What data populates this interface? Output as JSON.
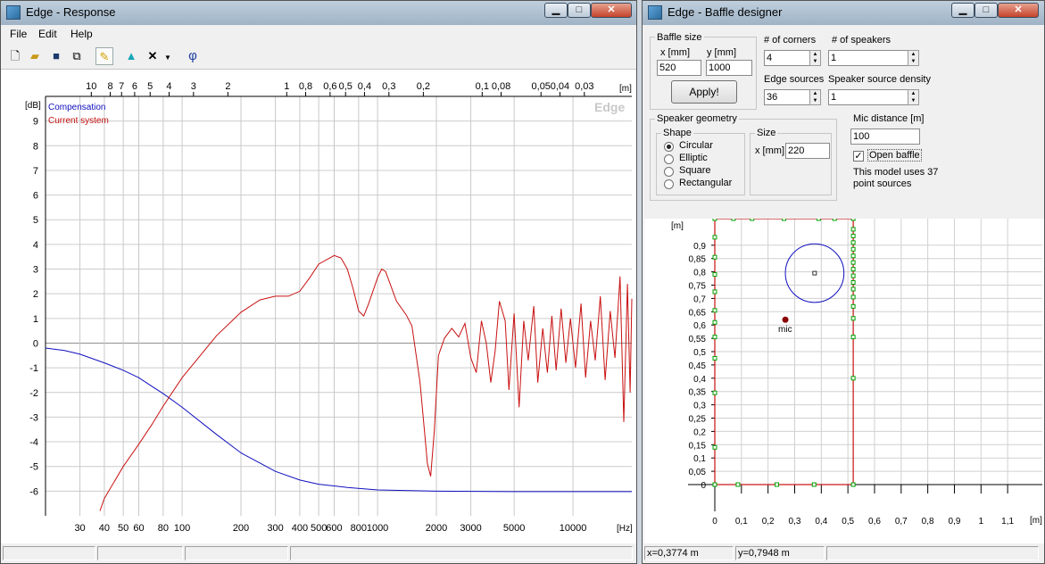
{
  "response_window": {
    "title": "Edge - Response",
    "menu": [
      "File",
      "Edit",
      "Help"
    ],
    "toolbar": {
      "phase_label": "φ"
    },
    "watermark": "Edge",
    "legend": [
      "Compensation",
      "Current system"
    ]
  },
  "designer_window": {
    "title": "Edge - Baffle designer",
    "baffle_size": {
      "group_label": "Baffle size",
      "x_label": "x [mm]",
      "x_value": "520",
      "y_label": "y [mm]",
      "y_value": "1000",
      "apply_label": "Apply!"
    },
    "corners": {
      "label": "# of corners",
      "value": "4"
    },
    "speakers": {
      "label": "# of speakers",
      "value": "1"
    },
    "edge_sources": {
      "label": "Edge sources",
      "value": "36"
    },
    "speaker_density": {
      "label": "Speaker source density",
      "value": "1"
    },
    "speaker_geometry": {
      "group_label": "Speaker geometry",
      "shape_label": "Shape",
      "shapes": [
        "Circular",
        "Elliptic",
        "Square",
        "Rectangular"
      ],
      "selected": "Circular",
      "size_label": "Size",
      "size_unit": "x [mm]",
      "size_value": "220"
    },
    "mic_distance": {
      "label": "Mic distance [m]",
      "value": "100"
    },
    "open_baffle": {
      "label": "Open baffle",
      "checked": true
    },
    "model_note": "This model uses 37 point sources",
    "status": {
      "x": "x=0,3774 m",
      "y": "y=0,7948 m"
    }
  },
  "chart_data": [
    {
      "type": "line",
      "title": "",
      "xlabel": "[Hz]",
      "ylabel": "[dB]",
      "xscale": "log",
      "xlim": [
        20,
        20000
      ],
      "ylim": [
        -7,
        10
      ],
      "x_ticks": [
        "30",
        "40",
        "50",
        "60",
        "80",
        "100",
        "200",
        "300",
        "400",
        "500",
        "600",
        "800",
        "1000",
        "2000",
        "3000",
        "5000",
        "10000"
      ],
      "y_ticks": [
        "9",
        "8",
        "7",
        "6",
        "5",
        "4",
        "3",
        "2",
        "1",
        "0",
        "-1",
        "-2",
        "-3",
        "-4",
        "-5",
        "-6"
      ],
      "top_axis_label": "[m]",
      "top_ticks": [
        "10",
        "8",
        "7",
        "6",
        "5",
        "4",
        "3",
        "2",
        "1",
        "0,8",
        "0,6",
        "0,5",
        "0,4",
        "0,3",
        "0,2",
        "0,1",
        "0,08",
        "0,05",
        "0,04",
        "0,03"
      ],
      "grid": true,
      "legend_position": "top-left",
      "series": [
        {
          "name": "Compensation",
          "color": "#1010c0",
          "points": [
            [
              20,
              -0.2
            ],
            [
              25,
              -0.3
            ],
            [
              30,
              -0.45
            ],
            [
              40,
              -0.8
            ],
            [
              50,
              -1.1
            ],
            [
              60,
              -1.4
            ],
            [
              70,
              -1.75
            ],
            [
              80,
              -2.05
            ],
            [
              100,
              -2.6
            ],
            [
              150,
              -3.7
            ],
            [
              200,
              -4.45
            ],
            [
              300,
              -5.2
            ],
            [
              400,
              -5.55
            ],
            [
              500,
              -5.72
            ],
            [
              700,
              -5.85
            ],
            [
              1000,
              -5.95
            ],
            [
              2000,
              -6.0
            ],
            [
              5000,
              -6.02
            ],
            [
              20000,
              -6.02
            ]
          ]
        },
        {
          "name": "Current system",
          "color": "#c81010",
          "points": [
            [
              38,
              -6.8
            ],
            [
              40,
              -6.3
            ],
            [
              50,
              -5.0
            ],
            [
              60,
              -4.1
            ],
            [
              70,
              -3.3
            ],
            [
              80,
              -2.55
            ],
            [
              100,
              -1.4
            ],
            [
              150,
              0.3
            ],
            [
              200,
              1.25
            ],
            [
              250,
              1.75
            ],
            [
              300,
              1.9
            ],
            [
              350,
              1.9
            ],
            [
              400,
              2.1
            ],
            [
              450,
              2.65
            ],
            [
              500,
              3.2
            ],
            [
              600,
              3.55
            ],
            [
              650,
              3.45
            ],
            [
              700,
              3.0
            ],
            [
              750,
              2.2
            ],
            [
              800,
              1.3
            ],
            [
              850,
              1.1
            ],
            [
              900,
              1.6
            ],
            [
              1000,
              2.65
            ],
            [
              1050,
              3.0
            ],
            [
              1100,
              2.9
            ],
            [
              1250,
              1.7
            ],
            [
              1400,
              1.15
            ],
            [
              1500,
              0.7
            ],
            [
              1650,
              -1.6
            ],
            [
              1800,
              -4.9
            ],
            [
              1870,
              -5.4
            ],
            [
              1950,
              -3.6
            ],
            [
              2050,
              -0.5
            ],
            [
              2200,
              0.2
            ],
            [
              2400,
              0.6
            ],
            [
              2600,
              0.25
            ],
            [
              2800,
              0.8
            ],
            [
              3000,
              -0.6
            ],
            [
              3200,
              -1.2
            ],
            [
              3400,
              0.9
            ],
            [
              3600,
              0.0
            ],
            [
              3800,
              -1.6
            ],
            [
              4000,
              -0.3
            ],
            [
              4200,
              1.7
            ],
            [
              4500,
              0.9
            ],
            [
              4700,
              -1.9
            ],
            [
              5000,
              1.2
            ],
            [
              5300,
              -2.6
            ],
            [
              5600,
              0.9
            ],
            [
              5900,
              -0.7
            ],
            [
              6300,
              1.5
            ],
            [
              6600,
              -1.6
            ],
            [
              7000,
              0.6
            ],
            [
              7400,
              -1.2
            ],
            [
              7800,
              1.1
            ],
            [
              8200,
              -1.1
            ],
            [
              8700,
              1.4
            ],
            [
              9200,
              -0.8
            ],
            [
              9700,
              1.0
            ],
            [
              10300,
              -1.0
            ],
            [
              11000,
              1.6
            ],
            [
              11600,
              -1.4
            ],
            [
              12300,
              0.9
            ],
            [
              13000,
              -0.7
            ],
            [
              13800,
              1.9
            ],
            [
              14600,
              -1.5
            ],
            [
              15500,
              1.3
            ],
            [
              16400,
              -0.6
            ],
            [
              17400,
              2.7
            ],
            [
              18200,
              -3.2
            ],
            [
              19000,
              2.4
            ],
            [
              19600,
              -2.0
            ],
            [
              20000,
              1.8
            ]
          ]
        }
      ]
    },
    {
      "type": "scatter",
      "title": "",
      "xlabel": "[m]",
      "ylabel": "[m]",
      "xlim": [
        0,
        1.2
      ],
      "ylim": [
        0,
        1.0
      ],
      "x_ticks": [
        "0",
        "0,1",
        "0,2",
        "0,3",
        "0,4",
        "0,5",
        "0,6",
        "0,7",
        "0,8",
        "0,9",
        "1",
        "1,1"
      ],
      "y_ticks": [
        "0",
        "0,05",
        "0,1",
        "0,15",
        "0,2",
        "0,25",
        "0,3",
        "0,35",
        "0,4",
        "0,45",
        "0,5",
        "0,55",
        "0,6",
        "0,65",
        "0,7",
        "0,75",
        "0,8",
        "0,85",
        "0,9"
      ],
      "grid": true,
      "baffle": {
        "width": 0.52,
        "height": 1.0,
        "color": "#c81010"
      },
      "speaker": {
        "center": [
          0.375,
          0.795
        ],
        "diameter": 0.22,
        "color": "#1010c0"
      },
      "mic": {
        "label": "mic",
        "position": [
          0.265,
          0.62
        ],
        "color": "#8b0000"
      },
      "edge_source_color": "#00a000",
      "edge_sources": [
        [
          0,
          0
        ],
        [
          0.087,
          0
        ],
        [
          0.233,
          0
        ],
        [
          0.373,
          0
        ],
        [
          0.52,
          0
        ],
        [
          0,
          0.14
        ],
        [
          0,
          0.345
        ],
        [
          0,
          0.475
        ],
        [
          0,
          0.555
        ],
        [
          0,
          0.61
        ],
        [
          0,
          0.655
        ],
        [
          0,
          0.725
        ],
        [
          0,
          0.79
        ],
        [
          0,
          0.855
        ],
        [
          0,
          0.93
        ],
        [
          0.52,
          0.4
        ],
        [
          0.52,
          0.555
        ],
        [
          0.52,
          0.625
        ],
        [
          0.52,
          0.67
        ],
        [
          0.52,
          0.705
        ],
        [
          0.52,
          0.735
        ],
        [
          0.52,
          0.76
        ],
        [
          0.52,
          0.785
        ],
        [
          0.52,
          0.81
        ],
        [
          0.52,
          0.835
        ],
        [
          0.52,
          0.86
        ],
        [
          0.52,
          0.885
        ],
        [
          0.52,
          0.91
        ],
        [
          0.52,
          0.935
        ],
        [
          0.52,
          0.96
        ],
        [
          0,
          1
        ],
        [
          0.07,
          1
        ],
        [
          0.14,
          1
        ],
        [
          0.26,
          1
        ],
        [
          0.39,
          1
        ],
        [
          0.45,
          1
        ],
        [
          0.52,
          1
        ]
      ]
    }
  ]
}
